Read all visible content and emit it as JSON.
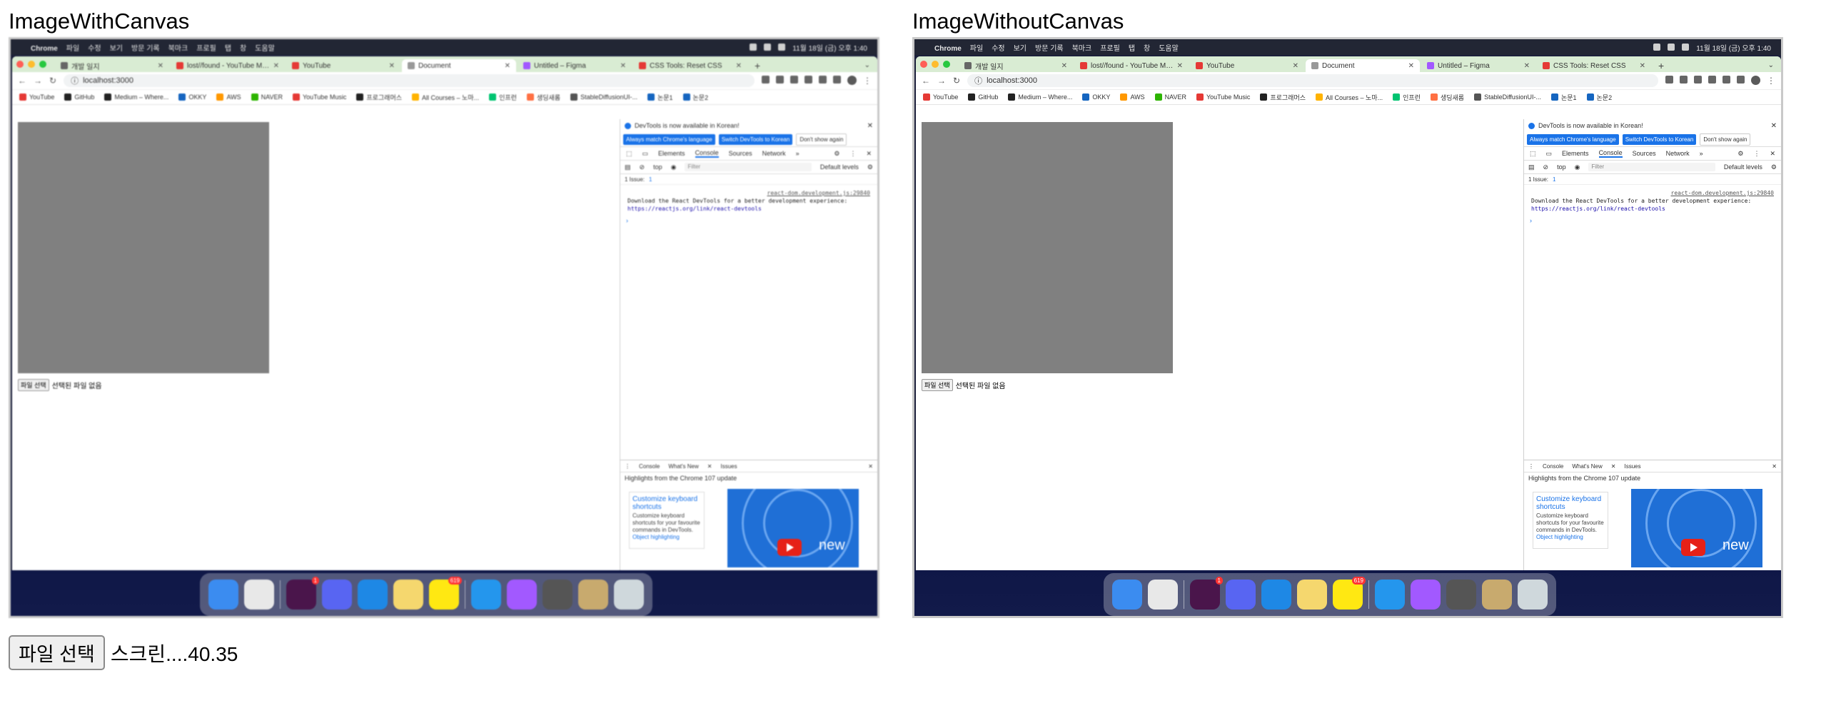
{
  "titles": {
    "left": "ImageWithCanvas",
    "right": "ImageWithoutCanvas"
  },
  "menubar": {
    "items": [
      "Chrome",
      "파일",
      "수정",
      "보기",
      "방문 기록",
      "북마크",
      "프로필",
      "탭",
      "창",
      "도움말"
    ],
    "datetime": "11월 18일 (금) 오후 1:40"
  },
  "tabs": [
    {
      "label": "개발 일지",
      "color": "#666666"
    },
    {
      "label": "lost//found - YouTube Music",
      "color": "#e53935"
    },
    {
      "label": "YouTube",
      "color": "#e53935"
    },
    {
      "label": "Document",
      "color": "#999999"
    },
    {
      "label": "Untitled – Figma",
      "color": "#a259ff"
    },
    {
      "label": "CSS Tools: Reset CSS",
      "color": "#e53935"
    }
  ],
  "address": {
    "url": "localhost:3000"
  },
  "bookmarks": [
    {
      "label": "YouTube",
      "color": "#e53935"
    },
    {
      "label": "GitHub",
      "color": "#222222"
    },
    {
      "label": "Medium – Where...",
      "color": "#222222"
    },
    {
      "label": "OKKY",
      "color": "#1565c0"
    },
    {
      "label": "AWS",
      "color": "#ff9800"
    },
    {
      "label": "NAVER",
      "color": "#2db400"
    },
    {
      "label": "YouTube Music",
      "color": "#e53935"
    },
    {
      "label": "프로그래머스",
      "color": "#222222"
    },
    {
      "label": "All Courses – 노마...",
      "color": "#ffb300"
    },
    {
      "label": "인프런",
      "color": "#00c471"
    },
    {
      "label": "생딩새롬",
      "color": "#ff7043"
    },
    {
      "label": "StableDiffusionUI-...",
      "color": "#555555"
    },
    {
      "label": "논문1",
      "color": "#1565c0"
    },
    {
      "label": "논문2",
      "color": "#1565c0"
    }
  ],
  "page": {
    "file_button": "파일 선택",
    "file_status": "선택된 파일 없음"
  },
  "devtools": {
    "notice": "DevTools is now available in Korean!",
    "btn_always": "Always match Chrome's language",
    "btn_switch": "Switch DevTools to Korean",
    "btn_dont": "Don't show again",
    "tabs": [
      "Elements",
      "Console",
      "Sources",
      "Network"
    ],
    "top": "top",
    "filter": "Filter",
    "levels": "Default levels",
    "issues": "1 Issue:",
    "issues_count": "1",
    "log_source": "react-dom.development.js:29840",
    "log_text": "Download the React DevTools for a better development experience:",
    "log_link": "https://reactjs.org/link/react-devtools",
    "drawer_tabs": [
      "Console",
      "What's New",
      "Issues"
    ],
    "drawer_heading": "Highlights from the Chrome 107 update",
    "card_title": "Customize keyboard shortcuts",
    "card_text": "Customize keyboard shortcuts for your favourite commands in DevTools.",
    "card_more": "Object highlighting",
    "promo_text": "new"
  },
  "dock": {
    "icons": [
      {
        "name": "finder-icon",
        "color": "#3b8cf0"
      },
      {
        "name": "chrome-icon",
        "color": "#e8e8e8"
      },
      {
        "sep": true
      },
      {
        "name": "slack-icon",
        "color": "#4a154b",
        "badge": "1"
      },
      {
        "name": "discord-icon",
        "color": "#5865f2"
      },
      {
        "name": "vscode-icon",
        "color": "#1e88e5"
      },
      {
        "name": "notes-icon",
        "color": "#f5d76e"
      },
      {
        "name": "kakaotalk-icon",
        "color": "#ffe812",
        "badge": "619"
      },
      {
        "sep": true
      },
      {
        "name": "docker-icon",
        "color": "#2496ed"
      },
      {
        "name": "figma-icon",
        "color": "#a259ff"
      },
      {
        "name": "calculator-icon",
        "color": "#555555"
      },
      {
        "name": "league-icon",
        "color": "#c8aa6e"
      },
      {
        "name": "trash-icon",
        "color": "#cfd8dc"
      }
    ]
  },
  "bottom": {
    "file_button": "파일 선택",
    "file_name": "스크린....40.35"
  }
}
